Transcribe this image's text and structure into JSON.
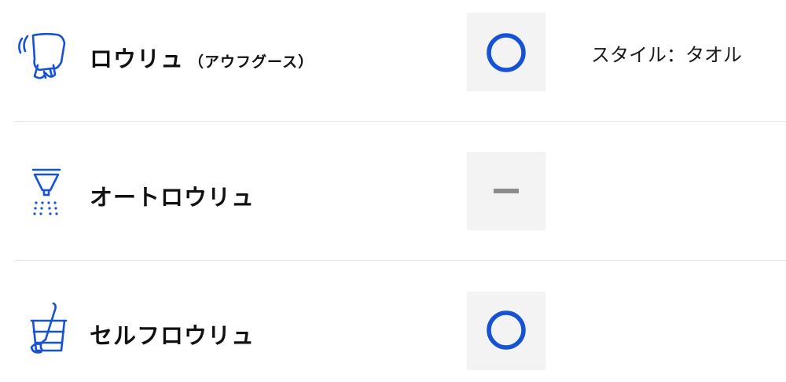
{
  "colors": {
    "accent": "#1552d6",
    "dash": "#8c8c8c",
    "status_bg": "#f3f3f3",
    "divider": "#e6e6e6"
  },
  "rows": [
    {
      "icon": "towel-waving-icon",
      "label": "ロウリュ",
      "sub_label": "（アウフグース）",
      "status": "○",
      "status_meaning": "available",
      "note": "スタイル：タオル"
    },
    {
      "icon": "auto-sprinkler-icon",
      "label": "オートロウリュ",
      "status": "－",
      "status_meaning": "not-available"
    },
    {
      "icon": "water-bucket-ladle-icon",
      "label": "セルフロウリュ",
      "status": "○",
      "status_meaning": "available"
    }
  ]
}
